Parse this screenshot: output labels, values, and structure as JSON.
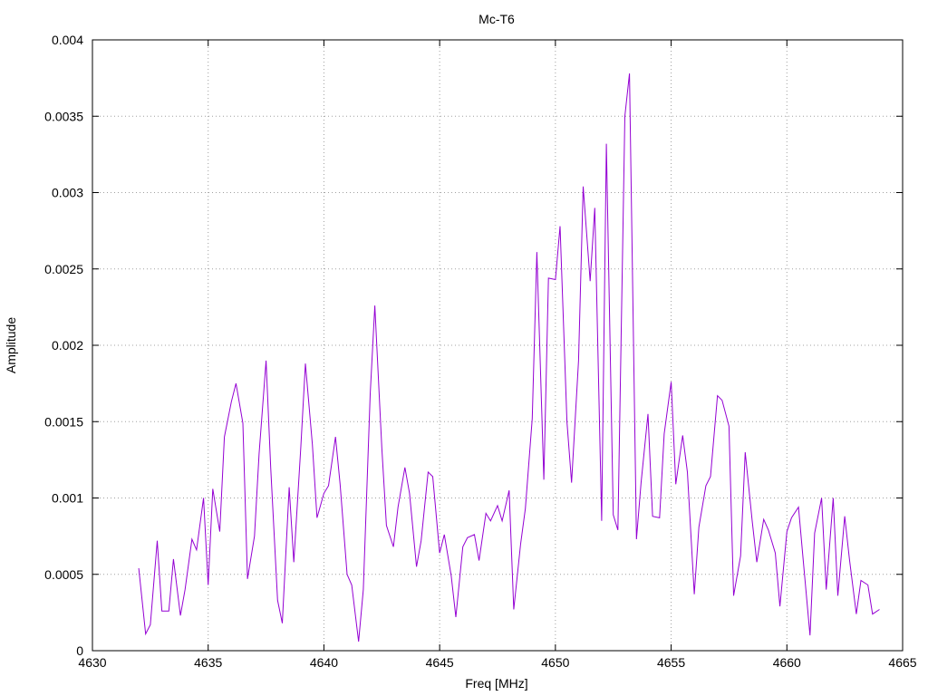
{
  "chart_data": {
    "type": "line",
    "title": "Mc-T6",
    "xlabel": "Freq [MHz]",
    "ylabel": "Amplitude",
    "xlim": [
      4630,
      4665
    ],
    "ylim": [
      0,
      0.004
    ],
    "xticks": [
      "4630",
      "4635",
      "4640",
      "4645",
      "4650",
      "4655",
      "4660",
      "4665"
    ],
    "yticks": [
      "0",
      "0.0005",
      "0.001",
      "0.0015",
      "0.002",
      "0.0025",
      "0.003",
      "0.0035",
      "0.004"
    ],
    "xtick_values": [
      4630,
      4635,
      4640,
      4645,
      4650,
      4655,
      4660,
      4665
    ],
    "ytick_values": [
      0,
      0.0005,
      0.001,
      0.0015,
      0.002,
      0.0025,
      0.003,
      0.0035,
      0.004
    ],
    "grid": true,
    "line_color": "#9400d3",
    "series": [
      {
        "x": [
          4632.0,
          4632.3,
          4632.5,
          4632.8,
          4633.0,
          4633.3,
          4633.5,
          4633.8,
          4634.0,
          4634.3,
          4634.5,
          4634.8,
          4635.0,
          4635.2,
          4635.5,
          4635.7,
          4636.0,
          4636.2,
          4636.5,
          4636.7,
          4637.0,
          4637.2,
          4637.5,
          4637.7,
          4638.0,
          4638.2,
          4638.5,
          4638.7,
          4639.0,
          4639.2,
          4639.5,
          4639.7,
          4640.0,
          4640.2,
          4640.5,
          4640.7,
          4641.0,
          4641.2,
          4641.5,
          4641.7,
          4642.0,
          4642.2,
          4642.5,
          4642.7,
          4643.0,
          4643.2,
          4643.5,
          4643.7,
          4644.0,
          4644.2,
          4644.5,
          4644.7,
          4645.0,
          4645.2,
          4645.5,
          4645.7,
          4646.0,
          4646.2,
          4646.5,
          4646.7,
          4647.0,
          4647.2,
          4647.5,
          4647.7,
          4648.0,
          4648.2,
          4648.5,
          4648.7,
          4649.0,
          4649.2,
          4649.5,
          4649.7,
          4650.0,
          4650.2,
          4650.5,
          4650.7,
          4651.0,
          4651.2,
          4651.5,
          4651.7,
          4652.0,
          4652.2,
          4652.5,
          4652.7,
          4653.0,
          4653.2,
          4653.5,
          4653.7,
          4654.0,
          4654.2,
          4654.5,
          4654.7,
          4655.0,
          4655.2,
          4655.5,
          4655.7,
          4656.0,
          4656.2,
          4656.5,
          4656.7,
          4657.0,
          4657.2,
          4657.5,
          4657.7,
          4658.0,
          4658.2,
          4658.5,
          4658.7,
          4659.0,
          4659.2,
          4659.5,
          4659.7,
          4660.0,
          4660.2,
          4660.5,
          4660.7,
          4661.0,
          4661.2,
          4661.5,
          4661.7,
          4662.0,
          4662.2,
          4662.5,
          4662.7,
          4663.0,
          4663.2,
          4663.5,
          4663.7,
          4664.0
        ],
        "values": [
          0.00054,
          0.00011,
          0.00017,
          0.00072,
          0.00026,
          0.00026,
          0.0006,
          0.00023,
          0.0004,
          0.00073,
          0.00066,
          0.001,
          0.00043,
          0.00106,
          0.00078,
          0.0014,
          0.00163,
          0.00175,
          0.00149,
          0.00047,
          0.00075,
          0.00129,
          0.0019,
          0.0012,
          0.00033,
          0.00018,
          0.00107,
          0.00058,
          0.00133,
          0.00188,
          0.00135,
          0.00087,
          0.00103,
          0.00108,
          0.0014,
          0.00109,
          0.0005,
          0.00043,
          6e-05,
          0.0004,
          0.00168,
          0.00226,
          0.00133,
          0.00082,
          0.00068,
          0.00094,
          0.0012,
          0.00103,
          0.00055,
          0.00072,
          0.00117,
          0.00114,
          0.00064,
          0.00076,
          0.00049,
          0.00022,
          0.00068,
          0.00074,
          0.00076,
          0.00059,
          0.0009,
          0.00085,
          0.00095,
          0.00085,
          0.00105,
          0.00027,
          0.0007,
          0.00093,
          0.00152,
          0.00261,
          0.00112,
          0.00244,
          0.00243,
          0.00278,
          0.0015,
          0.0011,
          0.0019,
          0.00304,
          0.00242,
          0.0029,
          0.00085,
          0.00332,
          0.00089,
          0.00079,
          0.0035,
          0.00378,
          0.00073,
          0.0011,
          0.00155,
          0.00088,
          0.00087,
          0.00142,
          0.00176,
          0.00109,
          0.00141,
          0.00117,
          0.00037,
          0.00081,
          0.00108,
          0.00114,
          0.00167,
          0.00164,
          0.00147,
          0.00036,
          0.00062,
          0.0013,
          0.00085,
          0.00058,
          0.00086,
          0.00079,
          0.00064,
          0.00029,
          0.00078,
          0.00087,
          0.00094,
          0.0006,
          0.0001,
          0.00077,
          0.001,
          0.0004,
          0.001,
          0.00036,
          0.00088,
          0.0006,
          0.00024,
          0.00046,
          0.00043,
          0.00024,
          0.00027
        ]
      }
    ]
  }
}
